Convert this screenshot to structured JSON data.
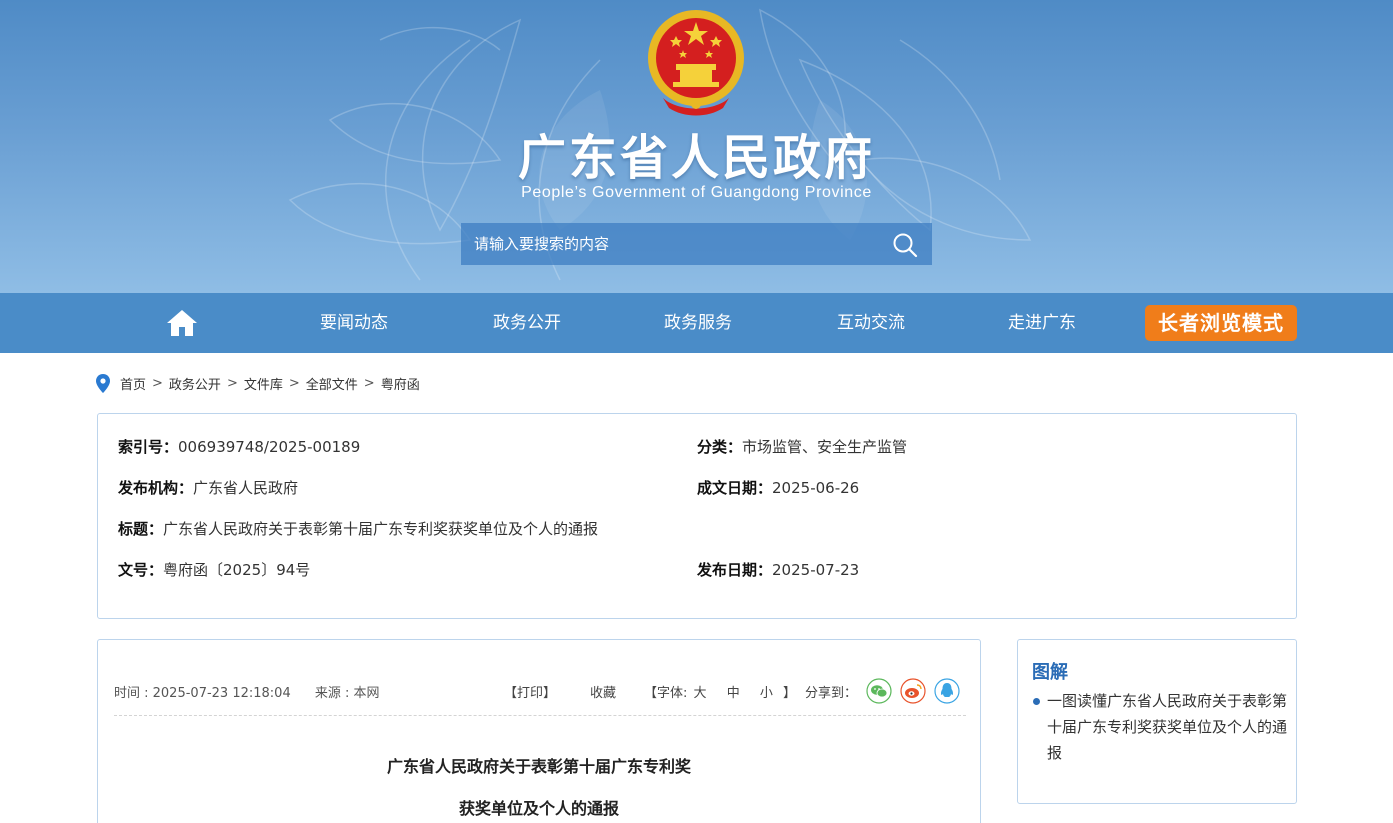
{
  "header": {
    "title": "广东省人民政府",
    "subtitle": "People’s Government of Guangdong Province",
    "search_placeholder": "请输入要搜索的内容",
    "colors": {
      "header_top": "#4f8bc6",
      "header_bottom": "#8fbde5"
    }
  },
  "nav": {
    "home_icon": "home-icon",
    "items": [
      "要闻动态",
      "政务公开",
      "政务服务",
      "互动交流",
      "走进广东"
    ],
    "elder_mode": "长者浏览模式",
    "colors": {
      "bar": "#4a8cc8",
      "elder": "#f07d1a"
    }
  },
  "breadcrumb": {
    "icon": "location-pin-icon",
    "separator": ">",
    "items": [
      "首页",
      "政务公开",
      "文件库",
      "全部文件",
      "粤府函"
    ]
  },
  "meta": {
    "index_key": "索引号：",
    "index_val": "006939748/2025-00189",
    "category_key": "分类：",
    "category_val": "市场监管、安全生产监管",
    "publisher_key": "发布机构：",
    "publisher_val": "广东省人民政府",
    "created_key": "成文日期：",
    "created_val": "2025-06-26",
    "title_key": "标题：",
    "title_val": "广东省人民政府关于表彰第十届广东专利奖获奖单位及个人的通报",
    "docno_key": "文号：",
    "docno_val": "粤府函〔2025〕94号",
    "published_key": "发布日期：",
    "published_val": "2025-07-23"
  },
  "article": {
    "time": "时间 : 2025-07-23 12:18:04",
    "source": "来源 : 本网",
    "print": "【打印】",
    "favorite": "收藏",
    "font_label": "【字体:",
    "font_large": "大",
    "font_medium": "中",
    "font_small": "小",
    "font_close": "】",
    "share_label": "分享到：",
    "share_icons": [
      "wechat-icon",
      "weibo-icon",
      "qq-icon"
    ],
    "title_line1": "广东省人民政府关于表彰第十届广东专利奖",
    "title_line2": "获奖单位及个人的通报"
  },
  "sidebar": {
    "title": "图解",
    "item": "一图读懂广东省人民政府关于表彰第十届广东专利奖获奖单位及个人的通报"
  }
}
